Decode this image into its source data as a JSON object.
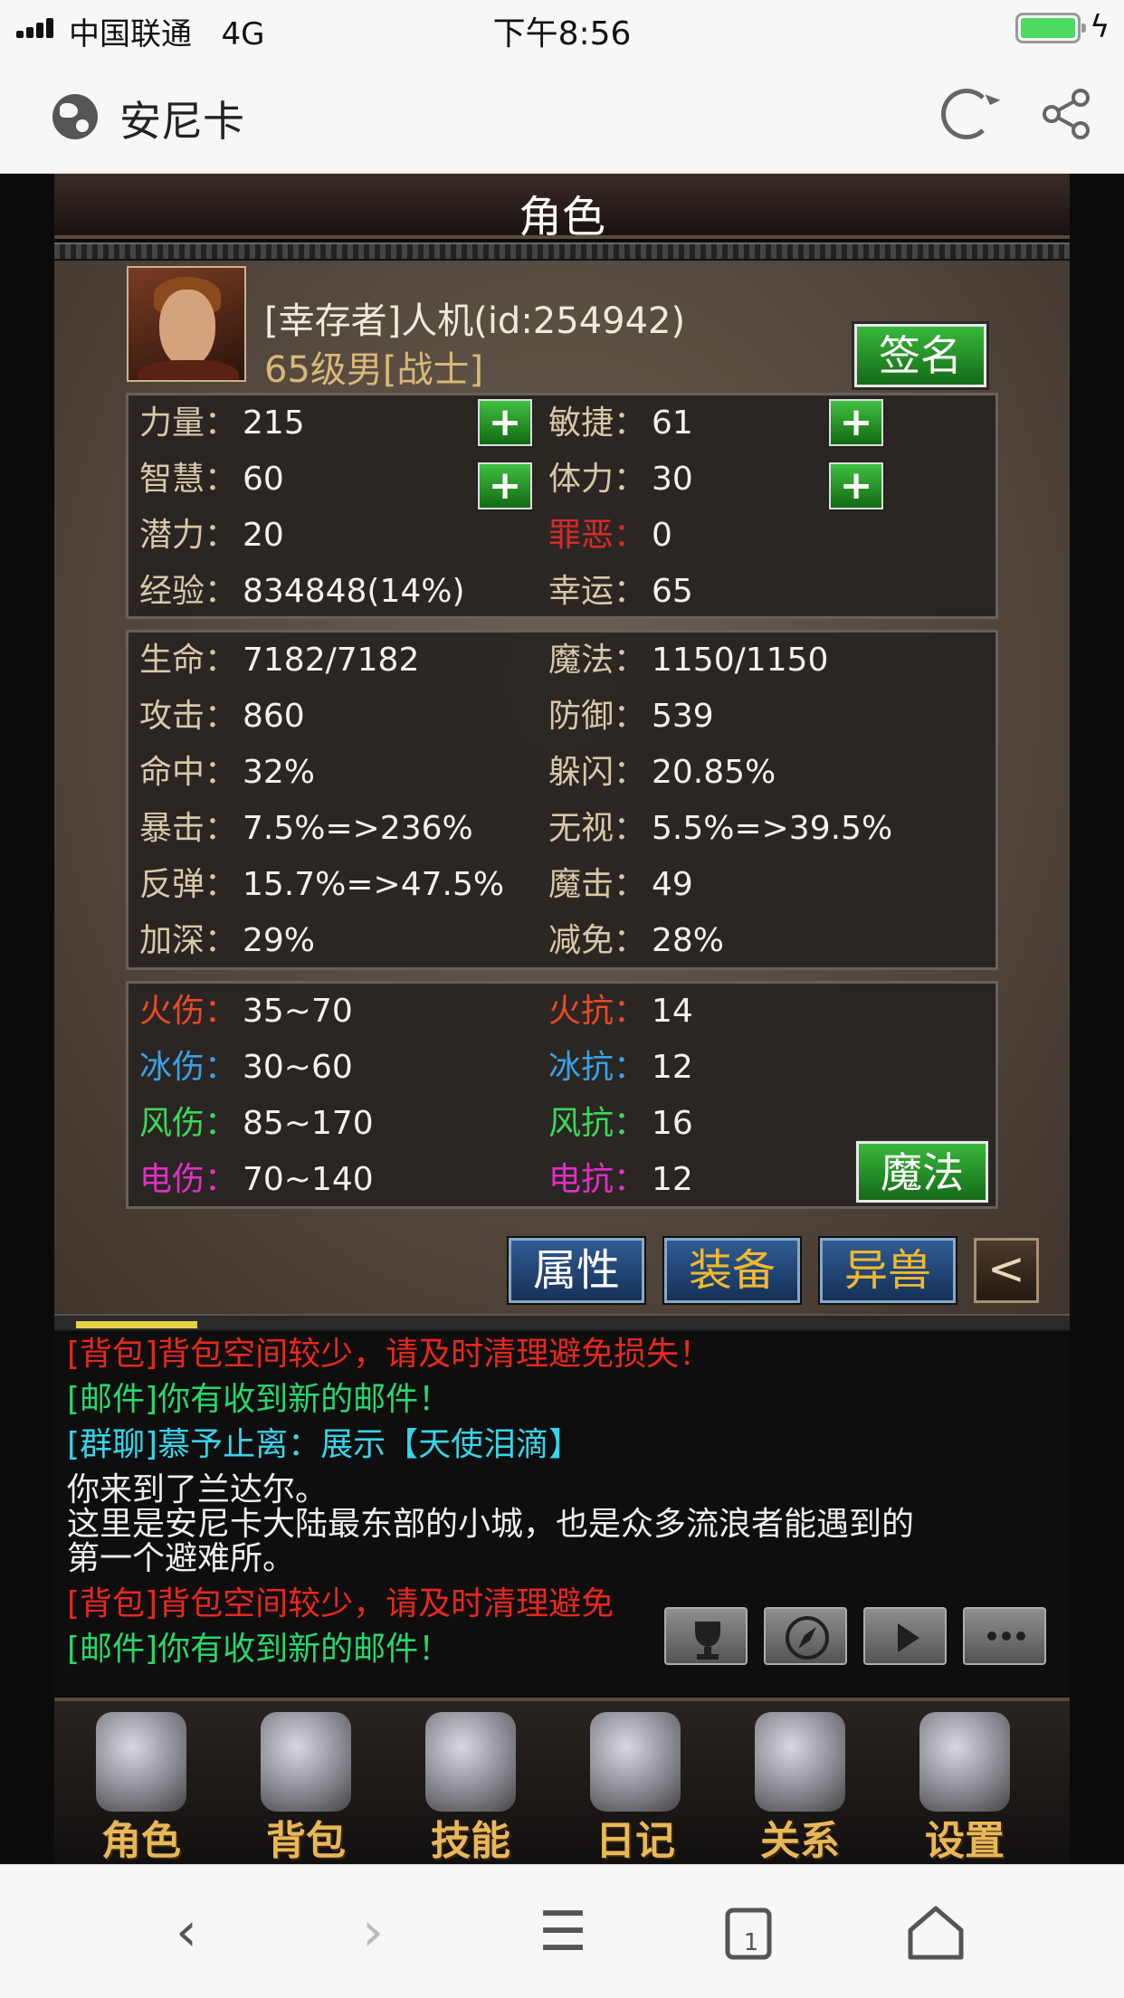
{
  "status_bar": {
    "carrier": "中国联通",
    "network": "4G",
    "time": "下午8:56"
  },
  "browser": {
    "site_title": "安尼卡"
  },
  "panel": {
    "title": "角色"
  },
  "player": {
    "name": "[幸存者]人机(id:254942)",
    "level_info": "65级男[战士]",
    "sign_button": "签名"
  },
  "attributes": [
    {
      "label": "力量：",
      "value": "215",
      "label2": "敏捷：",
      "value2": "61"
    },
    {
      "label": "智慧：",
      "value": "60",
      "label2": "体力：",
      "value2": "30"
    },
    {
      "label": "潜力：",
      "value": "20",
      "label2": "罪恶：",
      "value2": "0"
    },
    {
      "label": "经验：",
      "value": "834848(14%)",
      "label2": "幸运：",
      "value2": "65"
    }
  ],
  "combat": [
    {
      "label": "生命：",
      "value": "7182/7182",
      "label2": "魔法：",
      "value2": "1150/1150"
    },
    {
      "label": "攻击：",
      "value": "860",
      "label2": "防御：",
      "value2": "539"
    },
    {
      "label": "命中：",
      "value": "32%",
      "label2": "躲闪：",
      "value2": "20.85%"
    },
    {
      "label": "暴击：",
      "value": "7.5%=>236%",
      "label2": "无视：",
      "value2": "5.5%=>39.5%"
    },
    {
      "label": "反弹：",
      "value": "15.7%=>47.5%",
      "label2": "魔击：",
      "value2": "49"
    },
    {
      "label": "加深：",
      "value": "29%",
      "label2": "减免：",
      "value2": "28%"
    }
  ],
  "elements": [
    {
      "label": "火伤：",
      "value": "35~70",
      "label2": "火抗：",
      "value2": "14"
    },
    {
      "label": "冰伤：",
      "value": "30~60",
      "label2": "冰抗：",
      "value2": "12"
    },
    {
      "label": "风伤：",
      "value": "85~170",
      "label2": "风抗：",
      "value2": "16"
    },
    {
      "label": "电伤：",
      "value": "70~140",
      "label2": "电抗：",
      "value2": "12"
    }
  ],
  "magic_button": "魔法",
  "tabs": {
    "attr": "属性",
    "equip": "装备",
    "beast": "异兽",
    "back": "<"
  },
  "chat": [
    "[背包]背包空间较少，请及时清理避免损失！",
    "[邮件]你有收到新的邮件！",
    "[群聊]慕予止离：展示【天使泪滴】",
    "你来到了兰达尔。",
    "这里是安尼卡大陆最东部的小城，也是众多流浪者能遇到的",
    "第一个避难所。",
    "[背包]背包空间较少，请及时清理避免",
    "[邮件]你有收到新的邮件！"
  ],
  "nav": [
    "角色",
    "背包",
    "技能",
    "日记",
    "关系",
    "设置"
  ],
  "colors": {
    "warning": "#e8281e",
    "mail": "#27d86a",
    "group": "#37d4e8",
    "fire": "#e84a28",
    "ice": "#3aa0e8",
    "wind": "#3ad85a",
    "electric": "#e030c8",
    "sin": "#d82a2a",
    "gold_tab": "#f0b830"
  }
}
